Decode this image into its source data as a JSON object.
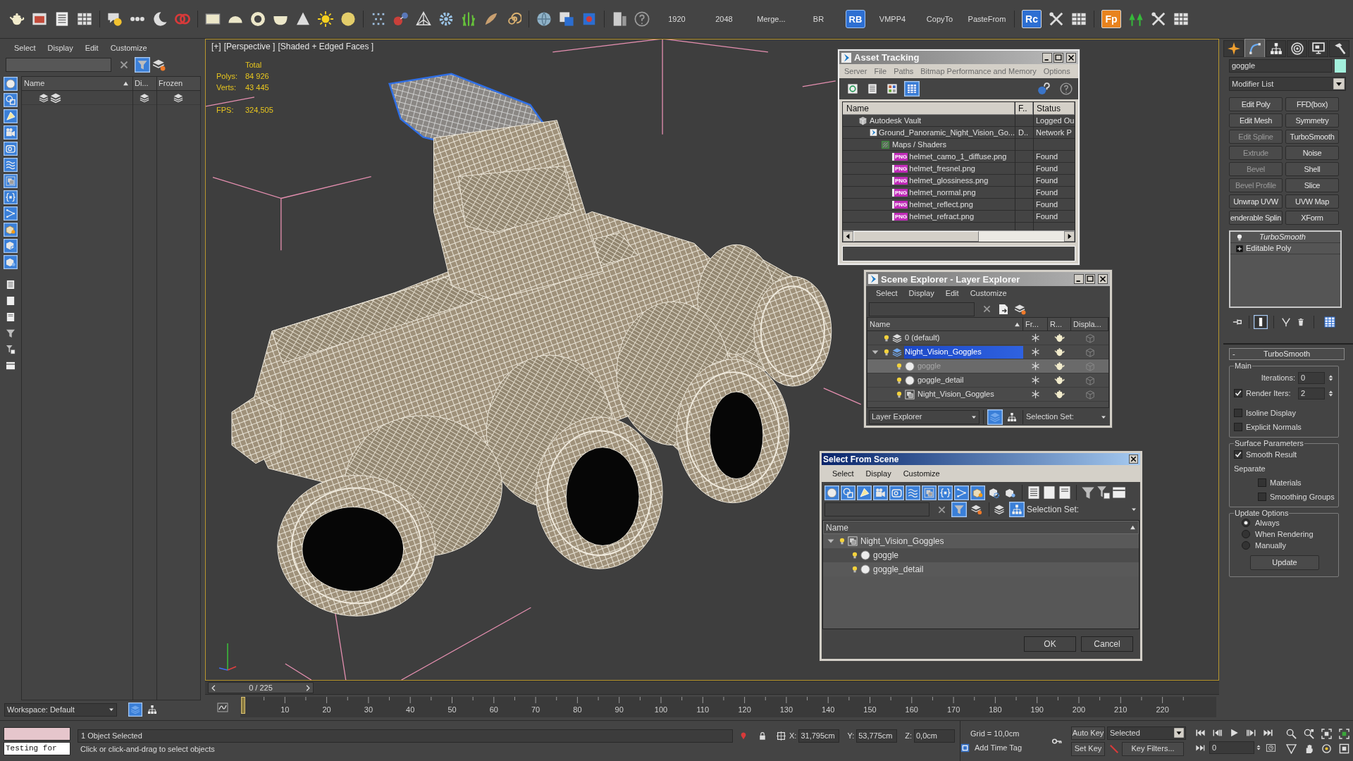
{
  "main_toolbar": {
    "script_buttons": [
      {
        "kind": "text",
        "label": "1920"
      },
      {
        "kind": "text",
        "label": "2048"
      },
      {
        "kind": "text",
        "label": "Merge..."
      },
      {
        "kind": "text",
        "label": "BR"
      },
      {
        "kind": "tile",
        "label": "RB",
        "color": "#2d6fd2"
      },
      {
        "kind": "text",
        "label": "VMPP4"
      },
      {
        "kind": "text",
        "label": "CopyTo"
      },
      {
        "kind": "text",
        "label": "PasteFrom"
      }
    ],
    "plugin_tiles": [
      {
        "label": "Rc",
        "color": "#2d6fd2"
      },
      {
        "label": "Fp",
        "color": "#e8831e"
      }
    ]
  },
  "scene_explorer": {
    "menu": [
      "Select",
      "Display",
      "Edit",
      "Customize"
    ],
    "filter_active": true,
    "filter_toggles": [
      {
        "on": true
      },
      {
        "on": true
      },
      {
        "on": true
      },
      {
        "on": true
      },
      {
        "on": true
      },
      {
        "on": true
      },
      {
        "on": true
      },
      {
        "on": true
      },
      {
        "on": true
      },
      {
        "on": true
      },
      {
        "on": true
      },
      {
        "on": true
      }
    ],
    "columns": [
      "Name",
      "Di...",
      "Frozen"
    ],
    "workspace": "Workspace: Default",
    "view_toggles": [
      {
        "on": true
      },
      {
        "on": false
      }
    ]
  },
  "viewport": {
    "labels": [
      "[+]",
      "[Perspective ]",
      "[Shaded + Edged Faces ]"
    ],
    "stats": {
      "heading": "Total",
      "rows": [
        {
          "label": "Polys:",
          "value": "84 926"
        },
        {
          "label": "Verts:",
          "value": "43 445"
        }
      ]
    },
    "fps": {
      "label": "FPS:",
      "value": "324,505"
    }
  },
  "asset_tracking": {
    "title": "Asset Tracking",
    "menu": [
      "Server",
      "File",
      "Paths",
      "Bitmap Performance and Memory",
      "Options"
    ],
    "toolbar_toggles": [
      {
        "on": false
      },
      {
        "on": false
      },
      {
        "on": false
      },
      {
        "on": true
      }
    ],
    "columns": [
      "Name",
      "F..",
      "Status"
    ],
    "tree": [
      {
        "kind": "vault",
        "name": "Autodesk Vault",
        "status": "Logged Ou",
        "children": [
          {
            "kind": "scene",
            "name": "Ground_Panoramic_Night_Vision_Go...",
            "column_2": "D..",
            "status": "Network P",
            "children": [
              {
                "kind": "folder",
                "name": "Maps / Shaders",
                "children": [
                  {
                    "kind": "file",
                    "badge": "PNG",
                    "name": "helmet_camo_1_diffuse.png",
                    "status": "Found"
                  },
                  {
                    "kind": "file",
                    "badge": "PNG",
                    "name": "helmet_fresnel.png",
                    "status": "Found"
                  },
                  {
                    "kind": "file",
                    "badge": "PNG",
                    "name": "helmet_glossiness.png",
                    "status": "Found"
                  },
                  {
                    "kind": "file",
                    "badge": "PNG",
                    "name": "helmet_normal.png",
                    "status": "Found"
                  },
                  {
                    "kind": "file",
                    "badge": "PNG",
                    "name": "helmet_reflect.png",
                    "status": "Found"
                  },
                  {
                    "kind": "file",
                    "badge": "PNG",
                    "name": "helmet_refract.png",
                    "status": "Found"
                  }
                ]
              }
            ]
          }
        ]
      }
    ]
  },
  "layer_explorer": {
    "title": "Scene Explorer - Layer Explorer",
    "menu": [
      "Select",
      "Display",
      "Edit",
      "Customize"
    ],
    "columns": [
      "Name",
      "Fr...",
      "R...",
      "Displa..."
    ],
    "tree": [
      {
        "kind": "layer",
        "name": "0 (default)",
        "selected": false
      },
      {
        "kind": "layer",
        "name": "Night_Vision_Goggles",
        "selected": true,
        "expanded": true,
        "children": [
          {
            "kind": "object",
            "name": "goggle",
            "selected": true
          },
          {
            "kind": "object",
            "name": "goggle_detail",
            "selected": false
          },
          {
            "kind": "group",
            "name": "Night_Vision_Goggles",
            "selected": false
          }
        ]
      }
    ],
    "view_dropdown": "Layer Explorer",
    "view_toggles": [
      {
        "on": true
      },
      {
        "on": false
      }
    ],
    "selection_set": "Selection Set:"
  },
  "select_from_scene": {
    "title": "Select From Scene",
    "menu": [
      "Select",
      "Display",
      "Customize"
    ],
    "filter_toggles": [
      {
        "on": true
      },
      {
        "on": true
      },
      {
        "on": true
      },
      {
        "on": true
      },
      {
        "on": true
      },
      {
        "on": true
      },
      {
        "on": true
      },
      {
        "on": true
      },
      {
        "on": true
      },
      {
        "on": true
      },
      {
        "on": false
      },
      {
        "on": false
      }
    ],
    "toolbar_toggles": [
      {
        "on": true
      },
      {
        "on": false
      },
      {
        "on": false
      },
      {
        "on": true
      }
    ],
    "selection_set": "Selection Set:",
    "columns": [
      "Name"
    ],
    "tree": [
      {
        "kind": "group",
        "name": "Night_Vision_Goggles",
        "selected": false,
        "expanded": true,
        "children": [
          {
            "kind": "object",
            "name": "goggle",
            "selected": true
          },
          {
            "kind": "object",
            "name": "goggle_detail",
            "selected": false
          }
        ]
      }
    ],
    "buttons": [
      "OK",
      "Cancel"
    ]
  },
  "command_panel": {
    "tabs": [
      {
        "selected": false
      },
      {
        "selected": true
      },
      {
        "selected": false
      },
      {
        "selected": false
      },
      {
        "selected": false
      },
      {
        "selected": false
      }
    ],
    "object": {
      "name": "goggle",
      "color": "#a3f0dc"
    },
    "modifier_list": "Modifier List",
    "modifier_buttons": [
      {
        "label": "Edit Poly",
        "disabled": false
      },
      {
        "label": "FFD(box)",
        "disabled": false
      },
      {
        "label": "Edit Mesh",
        "disabled": false
      },
      {
        "label": "Symmetry",
        "disabled": false
      },
      {
        "label": "Edit Spline",
        "disabled": true
      },
      {
        "label": "TurboSmooth",
        "disabled": false
      },
      {
        "label": "Extrude",
        "disabled": true
      },
      {
        "label": "Noise",
        "disabled": false
      },
      {
        "label": "Bevel",
        "disabled": true
      },
      {
        "label": "Shell",
        "disabled": false
      },
      {
        "label": "Bevel Profile",
        "disabled": true
      },
      {
        "label": "Slice",
        "disabled": false
      },
      {
        "label": "Unwrap UVW",
        "disabled": false
      },
      {
        "label": "UVW Map",
        "disabled": false
      },
      {
        "label": "enderable Splin",
        "disabled": false
      },
      {
        "label": "XForm",
        "disabled": false
      }
    ],
    "stack": [
      {
        "kind": "modifier",
        "name": "TurboSmooth"
      },
      {
        "kind": "base",
        "name": "Editable Poly"
      }
    ],
    "show_end_result": true,
    "rollout": {
      "collapse_mark": "-",
      "title": "TurboSmooth",
      "groups": [
        {
          "title": "Main",
          "controls": [
            {
              "kind": "spinner",
              "label": "Iterations:",
              "value": "0"
            },
            {
              "kind": "check_spinner",
              "label": "Render Iters:",
              "checked": true,
              "value": "2"
            },
            {
              "kind": "checkbox",
              "label": "Isoline Display",
              "checked": false
            },
            {
              "kind": "checkbox",
              "label": "Explicit Normals",
              "checked": false
            }
          ]
        },
        {
          "title": "Surface Parameters",
          "controls": [
            {
              "kind": "checkbox",
              "label": "Smooth Result",
              "checked": true
            },
            {
              "kind": "label",
              "label": "Separate",
              "children": [
                {
                  "kind": "checkbox",
                  "label": "Materials",
                  "checked": false
                },
                {
                  "kind": "checkbox",
                  "label": "Smoothing Groups",
                  "checked": false
                }
              ]
            }
          ]
        },
        {
          "title": "Update Options",
          "controls": [
            {
              "kind": "radio",
              "label": "Always",
              "selected": true
            },
            {
              "kind": "radio",
              "label": "When Rendering",
              "selected": false
            },
            {
              "kind": "radio",
              "label": "Manually",
              "selected": false
            },
            {
              "kind": "button",
              "label": "Update"
            }
          ]
        }
      ]
    }
  },
  "time_slider": {
    "position": "0 / 225",
    "level": 0
  },
  "track_bar": {
    "labels": [
      "10",
      "20",
      "30",
      "40",
      "50",
      "60",
      "70",
      "80",
      "90",
      "100",
      "110",
      "120",
      "130",
      "140",
      "150",
      "160",
      "170",
      "180",
      "190",
      "200",
      "210",
      "220"
    ]
  },
  "status_bar": {
    "listener_output": "Testing for",
    "selection": "1 Object Selected",
    "prompt": "Click or click-and-drag to select objects",
    "coords": [
      {
        "label": "X:",
        "value": "31,795cm"
      },
      {
        "label": "Y:",
        "value": "53,775cm"
      },
      {
        "label": "Z:",
        "value": "0,0cm"
      }
    ],
    "grid": "Grid = 10,0cm",
    "time_tag": "Add Time Tag",
    "auto_key": "Auto Key",
    "key_set": "Selected",
    "set_key": "Set Key",
    "key_filters": "Key Filters...",
    "frame": "0"
  }
}
